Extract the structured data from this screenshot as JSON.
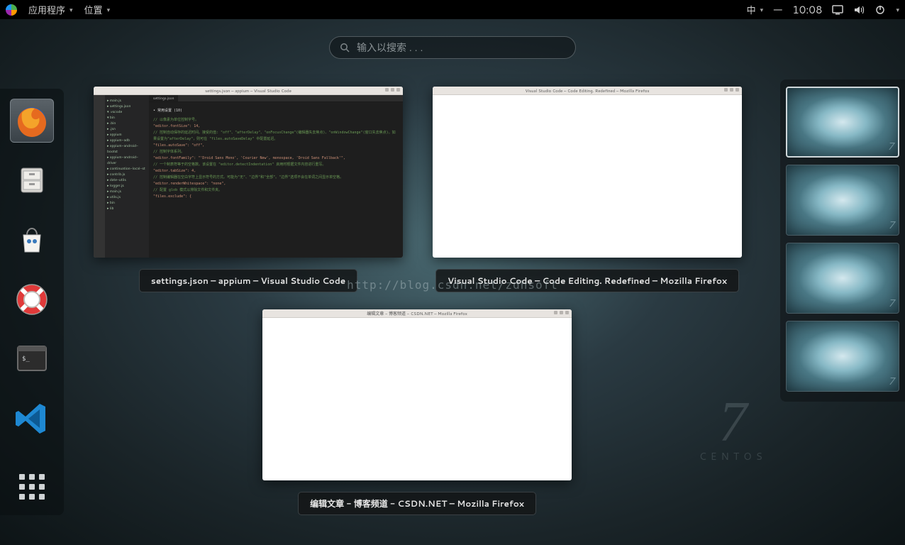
{
  "top_panel": {
    "applications": "应用程序",
    "places": "位置",
    "ime": "中",
    "day": "一",
    "time": "10:08"
  },
  "search": {
    "placeholder": "输入以搜索 . . ."
  },
  "dash": {
    "items": [
      {
        "name": "firefox",
        "label": "Firefox"
      },
      {
        "name": "files",
        "label": "Files"
      },
      {
        "name": "software",
        "label": "Software"
      },
      {
        "name": "help",
        "label": "Help"
      },
      {
        "name": "terminal",
        "label": "Terminal"
      },
      {
        "name": "vscode",
        "label": "Visual Studio Code"
      }
    ],
    "apps_button": "Show Applications"
  },
  "windows": [
    {
      "title_small": "settings.json – appium – Visual Studio Code",
      "label": "settings.json – appium – Visual Studio Code",
      "kind": "vscode",
      "vscode": {
        "tab": "settings.json",
        "section": "• 常用设置 (10)",
        "lines": [
          "// 以像素为单位控制字号。",
          "\"editor.fontSize\": 14,",
          "// 控制自动保存的延迟时间。接受的值: \"off\"、\"afterDelay\"、\"onFocusChange\"(编辑器失去焦点)、\"onWindowChange\"(窗口失去焦点)。如果设置为\"afterDelay\"，则可在 \"files.autoSaveDelay\" 中配置延迟。",
          "\"files.autoSave\": \"off\",",
          "// 控制字体系列。",
          "\"editor.fontFamily\": \"'Droid Sans Mono', 'Courier New', monospace, 'Droid Sans Fallback'\",",
          "// 一个制表符等于的空格数。该设置在 \"editor.detectIndentation\" 启用时根据文件内容进行重写。",
          "\"editor.tabSize\": 4,",
          "// 控制编辑器在空白字符上显示符号的方式。可能为\"无\"、\"边界\"和\"全部\"。\"边界\"选项不会在单词之间显示单空格。",
          "\"editor.renderWhitespace\": \"none\",",
          "// 配置 glob 模式以排除文件和文件夹。",
          "\"files.exclude\": {"
        ],
        "sidebar_items": [
          "▸ main.js",
          "▸ settings.json",
          "▾ .vscode",
          "▾ bin",
          "▸ .bin",
          "▸ .jsn",
          "▸ appium",
          "▸ appium-adb",
          "▸ appium-android-bootst",
          "▸ appium-android-driver",
          "▸ continuation-local-st",
          "▸ contrib.js",
          "▸ date-utils",
          "▸ logger.js",
          "▸ main.js",
          "▸ utils.js",
          "▸ bin",
          "▸ lib"
        ]
      }
    },
    {
      "title_small": "Visual Studio Code – Code Editing. Redefined – Mozilla Firefox",
      "label": "Visual Studio Code – Code Editing. Redefined – Mozilla Firefox",
      "kind": "blank"
    },
    {
      "title_small": "编辑文章 - 博客频道 - CSDN.NET – Mozilla Firefox",
      "label": "编辑文章 - 博客频道 - CSDN.NET – Mozilla Firefox",
      "kind": "blank"
    }
  ],
  "workspaces": {
    "count": 4,
    "active_index": 0,
    "marker": "7"
  },
  "watermark": "http://blog.csdn.net/zdhsoft",
  "brand": {
    "big": "7",
    "word": "CENTOS"
  }
}
